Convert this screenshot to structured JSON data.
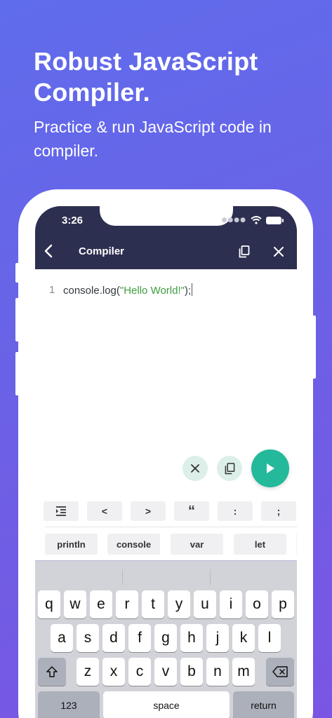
{
  "promo": {
    "headline": "Robust JavaScript Compiler.",
    "subline": "Practice & run JavaScript code in compiler."
  },
  "status_bar": {
    "time": "3:26"
  },
  "app_bar": {
    "title": "Compiler",
    "back_icon": "chevron-left-icon",
    "copy_icon": "copy-icon",
    "close_icon": "close-icon"
  },
  "editor": {
    "line_number": "1",
    "code_before": "console.log(",
    "code_string": "\"Hello World!\"",
    "code_after": ");"
  },
  "symbol_bar": [
    "indent",
    "<",
    ">",
    "“",
    ":",
    ";"
  ],
  "snippets": [
    "println",
    "console",
    "var",
    "let"
  ],
  "keyboard": {
    "row1": [
      "q",
      "w",
      "e",
      "r",
      "t",
      "y",
      "u",
      "i",
      "o",
      "p"
    ],
    "row2": [
      "a",
      "s",
      "d",
      "f",
      "g",
      "h",
      "j",
      "k",
      "l"
    ],
    "row3": [
      "z",
      "x",
      "c",
      "v",
      "b",
      "n",
      "m"
    ],
    "numbers_label": "123",
    "space_label": "space",
    "return_label": "return"
  },
  "colors": {
    "accent": "#23b99a",
    "appbar": "#2d2f50",
    "string": "#3e9b3e"
  }
}
